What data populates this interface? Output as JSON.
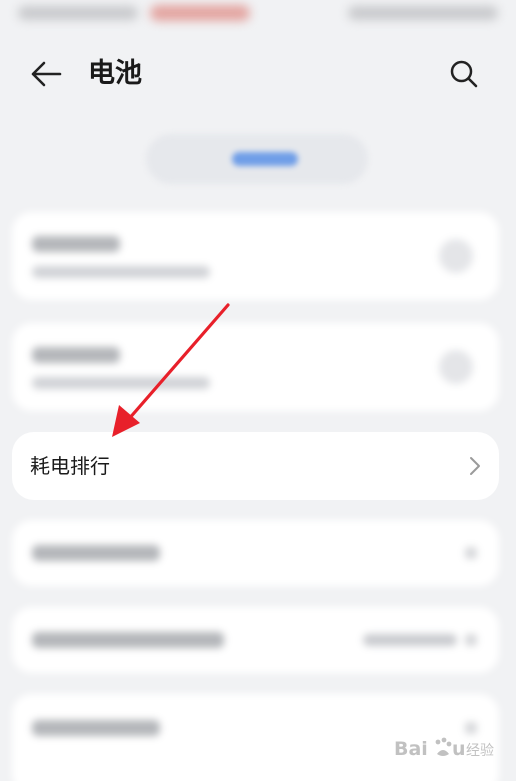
{
  "header": {
    "title": "电池",
    "back_icon": "arrow-left-icon",
    "search_icon": "search-icon"
  },
  "list": {
    "power_ranking_label": "耗电排行",
    "chevron_icon": "chevron-right-icon"
  },
  "annotation": {
    "arrow_color": "#e8202a"
  },
  "watermark": {
    "brand": "Baidu 经验"
  },
  "colors": {
    "background": "#f1f2f4",
    "card": "#ffffff",
    "text": "#1a1a1a",
    "chevron": "#9a9a9a"
  }
}
